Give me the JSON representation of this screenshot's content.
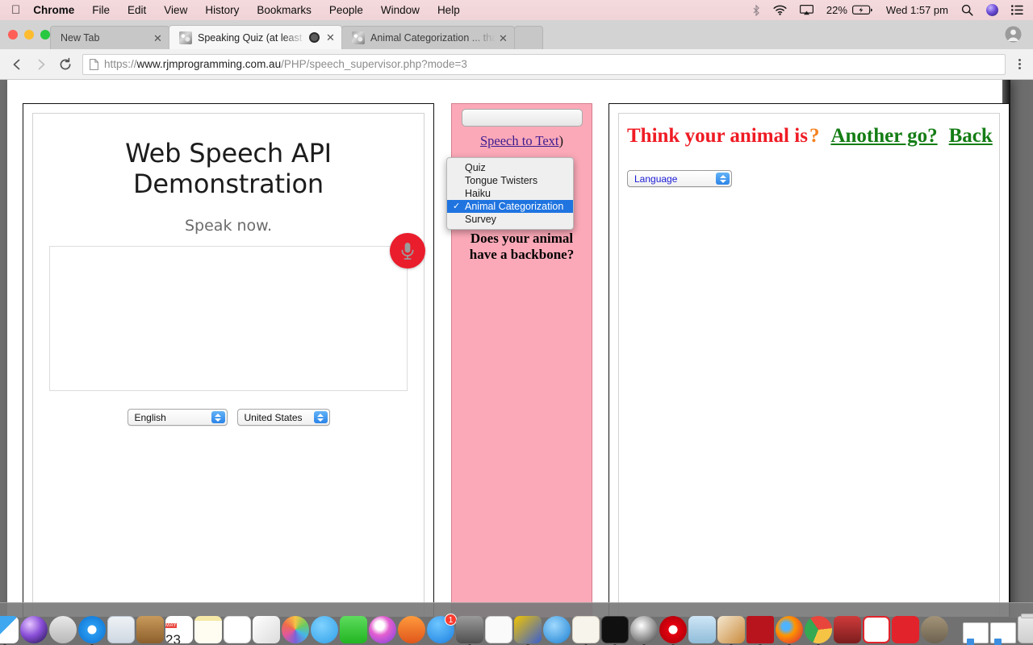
{
  "menubar": {
    "apple_icon": "apple-logo-icon",
    "items": [
      "Chrome",
      "File",
      "Edit",
      "View",
      "History",
      "Bookmarks",
      "People",
      "Window",
      "Help"
    ],
    "status": {
      "bluetooth_icon": "bluetooth-icon",
      "wifi_icon": "wifi-icon",
      "airplay_icon": "airplay-icon",
      "battery_percent": "22%",
      "battery_icon": "battery-charging-icon",
      "clock": "Wed 1:57 pm",
      "search_icon": "spotlight-search-icon",
      "siri_icon": "siri-icon",
      "notifications_icon": "notification-center-icon"
    }
  },
  "browser": {
    "tabs": [
      {
        "title": "New Tab",
        "active": false,
        "recording": false,
        "close_icon": "close-icon"
      },
      {
        "title": "Speaking Quiz (at least on C",
        "active": true,
        "recording": true,
        "close_icon": "close-icon"
      },
      {
        "title": "Animal Categorization ... thank",
        "active": false,
        "recording": false,
        "close_icon": "close-icon"
      }
    ],
    "traffic_lights": [
      "close-window-button",
      "minimize-window-button",
      "maximize-window-button"
    ],
    "profile_icon": "profile-avatar-icon",
    "toolbar": {
      "back_icon": "back-arrow-icon",
      "forward_icon": "forward-arrow-icon",
      "reload_icon": "reload-icon",
      "page_icon": "page-document-icon",
      "menu_icon": "three-dot-menu-icon"
    },
    "address": {
      "scheme": "https://",
      "host": "www.rjmprogramming.com.au",
      "path": "/PHP/speech_supervisor.php?mode=3",
      "full": "https://www.rjmprogramming.com.au/PHP/speech_supervisor.php?mode=3"
    }
  },
  "dropdown": {
    "items": [
      {
        "label": "Quiz",
        "checked": false
      },
      {
        "label": "Tongue Twisters",
        "checked": false
      },
      {
        "label": "Haiku",
        "checked": false
      },
      {
        "label": "Animal Categorization",
        "checked": true
      },
      {
        "label": "Survey",
        "checked": false
      }
    ],
    "check_glyph": "✓",
    "highlight_color": "#1f74e0"
  },
  "left_panel": {
    "title": "Web Speech API Demonstration",
    "status": "Speak now.",
    "mic_icon": "microphone-icon",
    "mic_color": "#ea1d2c",
    "transcript_value": "",
    "transcript_placeholder": "",
    "language_select": "English",
    "dialect_select": "United States"
  },
  "middle_panel": {
    "background_color": "#fba9b8",
    "mode_select_value": "",
    "speech_to_text_link": "Speech to Text",
    "speech_to_text_suffix": ")",
    "question": "Hear you have an unknown animal. Does your animal have a backbone?"
  },
  "right_panel": {
    "heading": "Think your animal is",
    "question_mark": "?",
    "heading_color": "#ef1b24",
    "question_mark_color": "#f58220",
    "link_color": "#147d14",
    "another_go_link": "Another go?",
    "back_link": "Back",
    "language_select": "Language"
  },
  "dock": {
    "items": [
      {
        "name": "finder",
        "label": "Finder",
        "running": true
      },
      {
        "name": "siri",
        "label": "Siri",
        "running": false
      },
      {
        "name": "launchpad",
        "label": "Launchpad",
        "running": false
      },
      {
        "name": "safari",
        "label": "Safari",
        "running": true
      },
      {
        "name": "mail",
        "label": "Mail",
        "running": false
      },
      {
        "name": "contacts",
        "label": "Contacts",
        "running": false
      },
      {
        "name": "calendar",
        "label": "Calendar",
        "running": false,
        "month": "MAY",
        "day": "23"
      },
      {
        "name": "notes",
        "label": "Notes",
        "running": false
      },
      {
        "name": "reminders",
        "label": "Reminders",
        "running": false
      },
      {
        "name": "news",
        "label": "News",
        "running": false
      },
      {
        "name": "photos",
        "label": "Photos",
        "running": false
      },
      {
        "name": "messages",
        "label": "Messages",
        "running": false
      },
      {
        "name": "facetime",
        "label": "FaceTime",
        "running": false
      },
      {
        "name": "itunes",
        "label": "iTunes",
        "running": false
      },
      {
        "name": "ibooks",
        "label": "iBooks",
        "running": false
      },
      {
        "name": "app-store",
        "label": "App Store",
        "running": false,
        "badge": "1"
      },
      {
        "name": "system-preferences",
        "label": "System Preferences",
        "running": true
      },
      {
        "name": "preview",
        "label": "Preview",
        "running": false
      },
      {
        "name": "wamp",
        "label": "Wamp",
        "running": true
      },
      {
        "name": "quicktime",
        "label": "QuickTime Player",
        "running": false
      },
      {
        "name": "font-book",
        "label": "Font Book",
        "running": true
      },
      {
        "name": "terminal",
        "label": "Terminal",
        "running": true
      },
      {
        "name": "mamp",
        "label": "MAMP",
        "running": true
      },
      {
        "name": "opera",
        "label": "Opera",
        "running": true
      },
      {
        "name": "image-capture",
        "label": "Image Capture",
        "running": false
      },
      {
        "name": "paintbrush",
        "label": "Paintbrush",
        "running": true
      },
      {
        "name": "filezilla",
        "label": "FileZilla",
        "running": true
      },
      {
        "name": "firefox",
        "label": "Firefox",
        "running": true
      },
      {
        "name": "chrome",
        "label": "Google Chrome",
        "running": true
      },
      {
        "name": "photo-booth",
        "label": "Photo Booth",
        "running": false
      },
      {
        "name": "sketchup",
        "label": "SketchUp",
        "running": false
      },
      {
        "name": "screenflow",
        "label": "ScreenFlow",
        "running": false
      },
      {
        "name": "gimp",
        "label": "GIMP",
        "running": false
      },
      {
        "name": "document-1",
        "label": "Document",
        "running": false
      },
      {
        "name": "document-2",
        "label": "Document",
        "running": false
      },
      {
        "name": "trash",
        "label": "Trash",
        "running": false
      }
    ]
  }
}
